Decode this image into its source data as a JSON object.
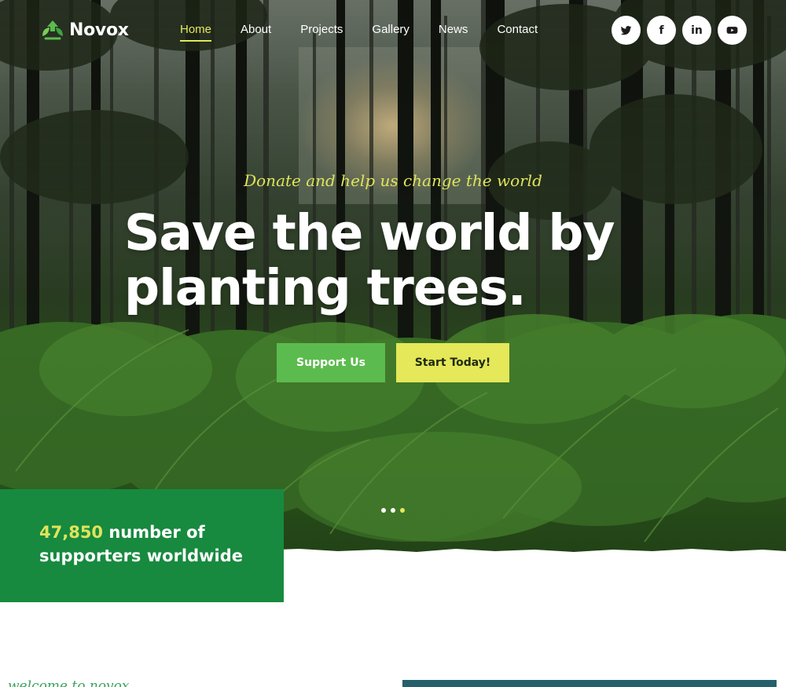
{
  "header": {
    "logo_text": "Novox",
    "nav": [
      {
        "label": "Home",
        "active": true
      },
      {
        "label": "About"
      },
      {
        "label": "Projects"
      },
      {
        "label": "Gallery"
      },
      {
        "label": "News"
      },
      {
        "label": "Contact"
      }
    ],
    "socials": [
      {
        "icon": "twitter-icon"
      },
      {
        "icon": "facebook-icon",
        "glyph": "f"
      },
      {
        "icon": "linkedin-icon",
        "glyph": "in"
      },
      {
        "icon": "youtube-icon"
      }
    ]
  },
  "hero": {
    "tagline": "Donate and help us change the world",
    "headline_line1": "Save the world by",
    "headline_line2": "planting trees.",
    "cta_primary": "Support Us",
    "cta_secondary": "Start Today!",
    "slider": {
      "count": 3,
      "active_index": 2
    }
  },
  "stats": {
    "number": "47,850",
    "text_line1": " number of",
    "text_line2": "supporters worldwide"
  },
  "below": {
    "welcome_label": "welcome to novox"
  },
  "colors": {
    "accent_yellow": "#e4e859",
    "brand_green": "#178a3f",
    "button_green": "#5cbb4e",
    "teal": "#23606b"
  }
}
